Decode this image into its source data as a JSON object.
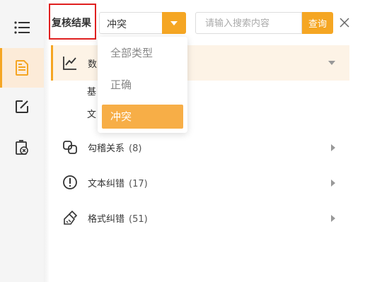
{
  "sidebar": {
    "items": [
      {
        "icon": "list-icon"
      },
      {
        "icon": "document-icon",
        "active": true
      },
      {
        "icon": "edit-icon"
      },
      {
        "icon": "clipboard-x-icon"
      }
    ]
  },
  "toolbar": {
    "filter_label": "复核结果",
    "select_value": "冲突",
    "search_placeholder": "请输入搜索内容",
    "query_label": "查询"
  },
  "dropdown": {
    "options": [
      "全部类型",
      "正确",
      "冲突"
    ],
    "selected": "冲突"
  },
  "list": {
    "items": [
      {
        "label": "数",
        "count": "",
        "icon": "chart-line-icon",
        "expanded": true,
        "children": [
          "基",
          "文"
        ]
      },
      {
        "label": "勾稽关系",
        "count": "(8)",
        "icon": "link-squares-icon"
      },
      {
        "label": "文本纠错",
        "count": "(17)",
        "icon": "alert-circle-icon"
      },
      {
        "label": "格式纠错",
        "count": "(51)",
        "icon": "brush-icon"
      }
    ]
  },
  "colors": {
    "accent": "#f5a623",
    "highlight_border": "#e02020",
    "active_bg": "#fdf3e6"
  }
}
